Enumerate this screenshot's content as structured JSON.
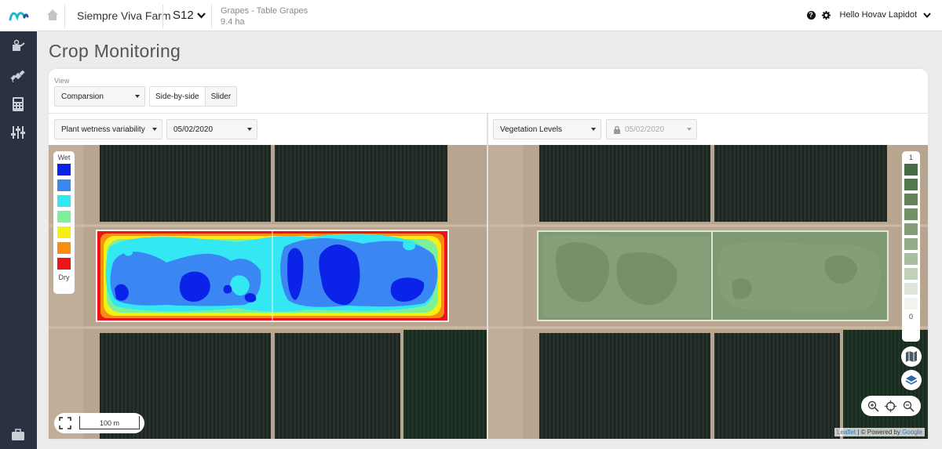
{
  "topbar": {
    "farm_name": "Siempre Viva Farm",
    "field_name": "S12",
    "crop_name": "Grapes - Table Grapes",
    "area": "9.4 ha",
    "greeting": "Hello Hovav Lapidot"
  },
  "page": {
    "title": "Crop Monitoring"
  },
  "view": {
    "label": "View",
    "mode_select": "Comparsion",
    "side_by_side": "Side-by-side",
    "slider": "Slider"
  },
  "left_panel": {
    "layer_select": "Plant wetness variability",
    "date_select": "05/02/2020",
    "legend_top": "Wet",
    "legend_bottom": "Dry",
    "legend_colors": [
      "#0b22e8",
      "#3a86f2",
      "#33e8f2",
      "#7df09a",
      "#f4ef14",
      "#f98c12",
      "#ec1515"
    ],
    "scale_label": "100 m"
  },
  "right_panel": {
    "layer_select": "Vegetation Levels",
    "date_select": "05/02/2020",
    "legend_top": "1",
    "legend_bottom": "0",
    "legend_colors": [
      "#476b45",
      "#55774f",
      "#648359",
      "#739067",
      "#829c77",
      "#94ab8a",
      "#a9bd9f",
      "#c2d1bb",
      "#dde6d9",
      "#f0f3ee"
    ],
    "attribution_link": "Leaflet",
    "attribution_text": "| © Powered by ",
    "attribution_google": "Google"
  }
}
